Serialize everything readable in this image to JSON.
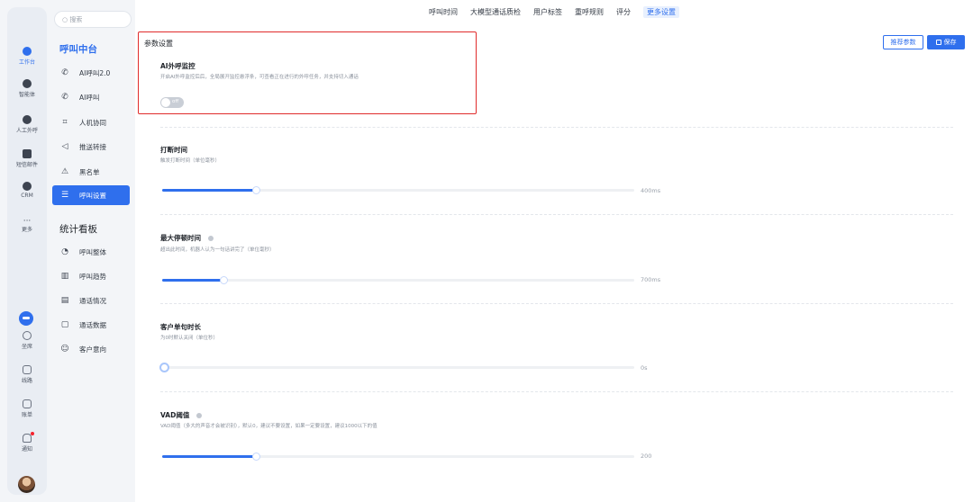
{
  "rail": {
    "items": [
      {
        "label": "工作台",
        "icon": "workbench-icon"
      },
      {
        "label": "智能体",
        "icon": "agent-icon"
      },
      {
        "label": "人工外呼",
        "icon": "manual-call-icon"
      },
      {
        "label": "短信邮件",
        "icon": "sms-mail-icon"
      },
      {
        "label": "CRM",
        "icon": "crm-icon"
      },
      {
        "label": "更多",
        "icon": "more-icon"
      }
    ],
    "bottom": [
      {
        "label": "坐席",
        "icon": "seat-icon"
      },
      {
        "label": "线路",
        "icon": "line-icon"
      },
      {
        "label": "账单",
        "icon": "bill-icon"
      },
      {
        "label": "通知",
        "icon": "bell-icon"
      }
    ],
    "accent": "#2f6fed"
  },
  "nav": {
    "search_placeholder": "搜索",
    "group1": "呼叫中台",
    "items1": [
      {
        "label": "AI呼叫2.0",
        "icon": "ai-call-v2-icon"
      },
      {
        "label": "AI呼叫",
        "icon": "phone-icon"
      },
      {
        "label": "人机协同",
        "icon": "scan-icon"
      },
      {
        "label": "推送转接",
        "icon": "send-icon"
      },
      {
        "label": "黑名单",
        "icon": "warning-icon"
      },
      {
        "label": "呼叫设置",
        "icon": "sliders-icon"
      }
    ],
    "group2": "统计看板",
    "items2": [
      {
        "label": "呼叫整体",
        "icon": "pie-icon"
      },
      {
        "label": "呼叫趋势",
        "icon": "bar-chart-icon"
      },
      {
        "label": "通话情况",
        "icon": "document-icon"
      },
      {
        "label": "通话数据",
        "icon": "doc-search-icon"
      },
      {
        "label": "客户意向",
        "icon": "smile-icon"
      }
    ]
  },
  "tabs": [
    "呼叫时间",
    "大模型通话质检",
    "用户标签",
    "重呼规则",
    "评分",
    "更多设置"
  ],
  "active_tab": "更多设置",
  "actions": {
    "recommend": "推荐参数",
    "save": "保存"
  },
  "panel": {
    "title": "参数设置",
    "monitor": {
      "title": "AI外呼监控",
      "desc": "开启AI外呼监控后后，全局展开监控悬浮条，可查看正在进行的外呼任务，并支持切入通话",
      "toggle_label": "off",
      "enabled": false
    },
    "interrupt": {
      "title": "打断时间",
      "desc": "触发打断时间（单位毫秒）",
      "value": "400ms",
      "fill": 0.2
    },
    "pause": {
      "title": "最大停顿时间",
      "desc": "超出此时间，机器人认为一句话讲完了（单位毫秒）",
      "value": "700ms",
      "fill": 0.13
    },
    "utterance": {
      "title": "客户单句时长",
      "desc": "为0时默认关闭（单位秒）",
      "value": "0s",
      "fill": 0
    },
    "vad": {
      "title": "VAD阈值",
      "desc": "VAD阈值（多大的声音才会被识别），默认0，建议不要设置，如果一定要设置，建议1000以下的值",
      "value": "200",
      "fill": 0.2
    }
  }
}
